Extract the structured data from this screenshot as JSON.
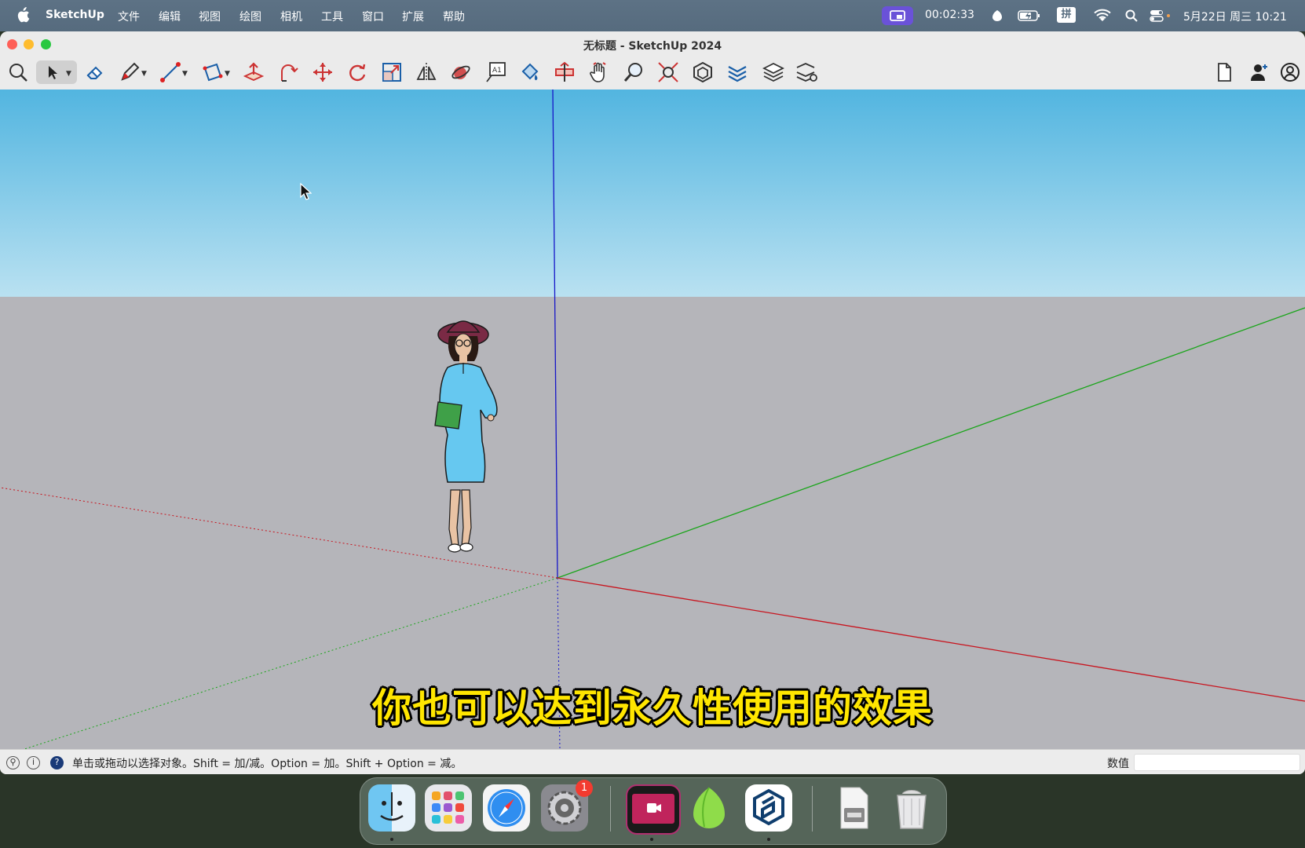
{
  "menubar": {
    "app_name": "SketchUp",
    "menus": [
      "文件",
      "编辑",
      "视图",
      "绘图",
      "相机",
      "工具",
      "窗口",
      "扩展",
      "帮助"
    ],
    "timer": "00:02:33",
    "input_method": "拼",
    "datetime": "5月22日 周三 10:21"
  },
  "window": {
    "title": "无标题 - SketchUp 2024"
  },
  "toolbar": {
    "tools": [
      "search",
      "select",
      "eraser",
      "pencil",
      "line",
      "rectangle",
      "push-pull",
      "follow-me",
      "move",
      "rotate",
      "scale",
      "flip",
      "orbit",
      "text",
      "paint",
      "section",
      "pan",
      "zoom",
      "zoom-extents",
      "components",
      "tags",
      "layers",
      "styles"
    ],
    "right_icons": [
      "document-icon",
      "user-icon",
      "account-icon"
    ]
  },
  "viewport": {
    "subtitle": "你也可以达到永久性使用的效果",
    "sky_color": "#52b5e0",
    "ground_color": "#b5b5ba"
  },
  "statusbar": {
    "hint": "单击或拖动以选择对象。Shift = 加/减。Option = 加。Shift + Option = 减。",
    "value_label": "数值",
    "value": ""
  },
  "dock": {
    "apps": [
      "Finder",
      "Launchpad",
      "Safari",
      "System Settings",
      "Screen Recorder",
      "Leaf App",
      "SketchUp",
      "File Manager",
      "Trash"
    ],
    "settings_badge": "1"
  }
}
